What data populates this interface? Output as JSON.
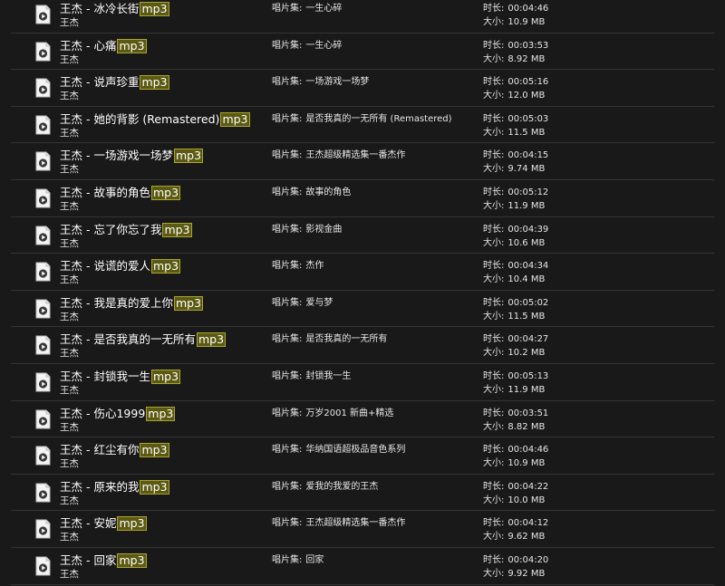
{
  "labels": {
    "album": "唱片集:",
    "duration": "时长:",
    "size": "大小:"
  },
  "icons": {
    "file": "media-file-icon"
  },
  "colors": {
    "background": "#191919",
    "highlight_bg": "#5c5a12",
    "highlight_border": "#a8a432",
    "divider": "#343434"
  },
  "files": [
    {
      "title": "王杰 - 冰冷长街",
      "ext": "mp3",
      "artist": "王杰",
      "album": "一生心碎",
      "duration": "00:04:46",
      "size": "10.9 MB"
    },
    {
      "title": "王杰 - 心痛",
      "ext": "mp3",
      "artist": "王杰",
      "album": "一生心碎",
      "duration": "00:03:53",
      "size": "8.92 MB"
    },
    {
      "title": "王杰 - 说声珍重",
      "ext": "mp3",
      "artist": "王杰",
      "album": "一场游戏一场梦",
      "duration": "00:05:16",
      "size": "12.0 MB"
    },
    {
      "title": "王杰 - 她的背影 (Remastered)",
      "ext": "mp3",
      "artist": "王杰",
      "album": "是否我真的一无所有 (Remastered)",
      "duration": "00:05:03",
      "size": "11.5 MB"
    },
    {
      "title": "王杰 - 一场游戏一场梦",
      "ext": "mp3",
      "artist": "王杰",
      "album": "王杰超级精选集一番杰作",
      "duration": "00:04:15",
      "size": "9.74 MB"
    },
    {
      "title": "王杰 - 故事的角色",
      "ext": "mp3",
      "artist": "王杰",
      "album": "故事的角色",
      "duration": "00:05:12",
      "size": "11.9 MB"
    },
    {
      "title": "王杰 - 忘了你忘了我",
      "ext": "mp3",
      "artist": "王杰",
      "album": "影视金曲",
      "duration": "00:04:39",
      "size": "10.6 MB"
    },
    {
      "title": "王杰 - 说谎的爱人",
      "ext": "mp3",
      "artist": "王杰",
      "album": "杰作",
      "duration": "00:04:34",
      "size": "10.4 MB"
    },
    {
      "title": "王杰 - 我是真的爱上你",
      "ext": "mp3",
      "artist": "王杰",
      "album": "爱与梦",
      "duration": "00:05:02",
      "size": "11.5 MB"
    },
    {
      "title": "王杰 - 是否我真的一无所有",
      "ext": "mp3",
      "artist": "王杰",
      "album": "是否我真的一无所有",
      "duration": "00:04:27",
      "size": "10.2 MB"
    },
    {
      "title": "王杰 - 封锁我一生",
      "ext": "mp3",
      "artist": "王杰",
      "album": "封锁我一生",
      "duration": "00:05:13",
      "size": "11.9 MB"
    },
    {
      "title": "王杰 - 伤心1999",
      "ext": "mp3",
      "artist": "王杰",
      "album": "万岁2001 新曲+精选",
      "duration": "00:03:51",
      "size": "8.82 MB"
    },
    {
      "title": "王杰 - 红尘有你",
      "ext": "mp3",
      "artist": "王杰",
      "album": "华纳国语超极品音色系列",
      "duration": "00:04:46",
      "size": "10.9 MB"
    },
    {
      "title": "王杰 - 原来的我",
      "ext": "mp3",
      "artist": "王杰",
      "album": "爱我的我爱的王杰",
      "duration": "00:04:22",
      "size": "10.0 MB"
    },
    {
      "title": "王杰 - 安妮",
      "ext": "mp3",
      "artist": "王杰",
      "album": "王杰超级精选集一番杰作",
      "duration": "00:04:12",
      "size": "9.62 MB"
    },
    {
      "title": "王杰 - 回家",
      "ext": "mp3",
      "artist": "王杰",
      "album": "回家",
      "duration": "00:04:20",
      "size": "9.92 MB"
    }
  ]
}
